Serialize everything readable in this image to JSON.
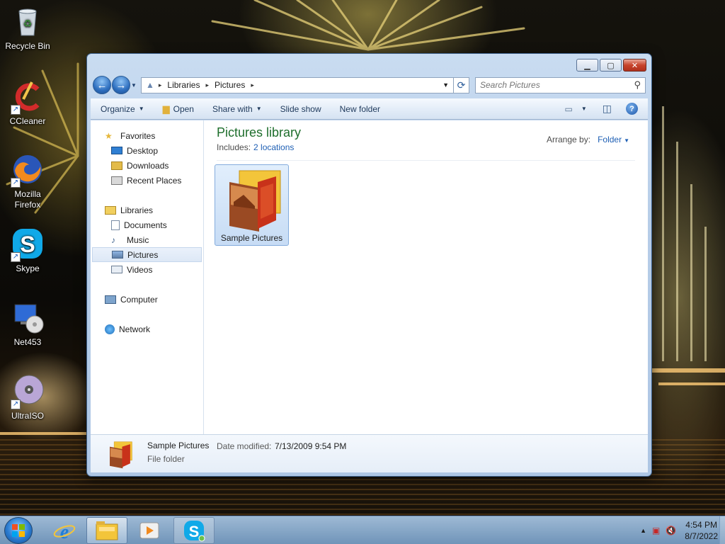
{
  "desktop": {
    "icons": [
      {
        "label": "Recycle Bin",
        "icon": "recycle-bin-icon"
      },
      {
        "label": "CCleaner",
        "icon": "ccleaner-icon"
      },
      {
        "label": "Mozilla Firefox",
        "icon": "firefox-icon"
      },
      {
        "label": "Skype",
        "icon": "skype-icon"
      },
      {
        "label": "Net453",
        "icon": "net453-icon"
      },
      {
        "label": "UltraISO",
        "icon": "ultraiso-icon"
      }
    ],
    "recycle_label": "Recycle Bin",
    "ccleaner_label": "CCleaner",
    "firefox_label": "Mozilla Firefox",
    "skype_label": "Skype",
    "net_label": "Net453",
    "ultraiso_label": "UltraISO"
  },
  "window": {
    "address": {
      "crumbs": [
        "Libraries",
        "Pictures"
      ],
      "crumb_0": "Libraries",
      "crumb_1": "Pictures"
    },
    "search": {
      "placeholder": "Search Pictures"
    },
    "toolbar": {
      "organize": "Organize",
      "open": "Open",
      "share_with": "Share with",
      "slide_show": "Slide show",
      "new_folder": "New folder"
    },
    "nav": {
      "favorites": "Favorites",
      "desktop": "Desktop",
      "downloads": "Downloads",
      "recent_places": "Recent Places",
      "libraries": "Libraries",
      "documents": "Documents",
      "music": "Music",
      "pictures": "Pictures",
      "videos": "Videos",
      "computer": "Computer",
      "network": "Network",
      "selected": "Pictures"
    },
    "library": {
      "title": "Pictures library",
      "includes_label": "Includes:",
      "locations_link": "2 locations",
      "arrange_label": "Arrange by:",
      "arrange_value": "Folder"
    },
    "items": [
      {
        "name": "Sample Pictures",
        "icon": "folder-pictures-icon",
        "selected": true
      }
    ],
    "item_0_name": "Sample Pictures",
    "details": {
      "name": "Sample Pictures",
      "modified_label": "Date modified:",
      "modified_value": "7/13/2009 9:54 PM",
      "type": "File folder"
    }
  },
  "taskbar": {
    "pinned": [
      "start-orb",
      "internet-explorer",
      "windows-explorer",
      "media-player",
      "skype"
    ],
    "clock_time": "4:54 PM",
    "clock_date": "8/7/2022"
  },
  "colors": {
    "library_title": "#1e6e2c",
    "link": "#1e5fb4",
    "selection": "#c7dcf5"
  }
}
